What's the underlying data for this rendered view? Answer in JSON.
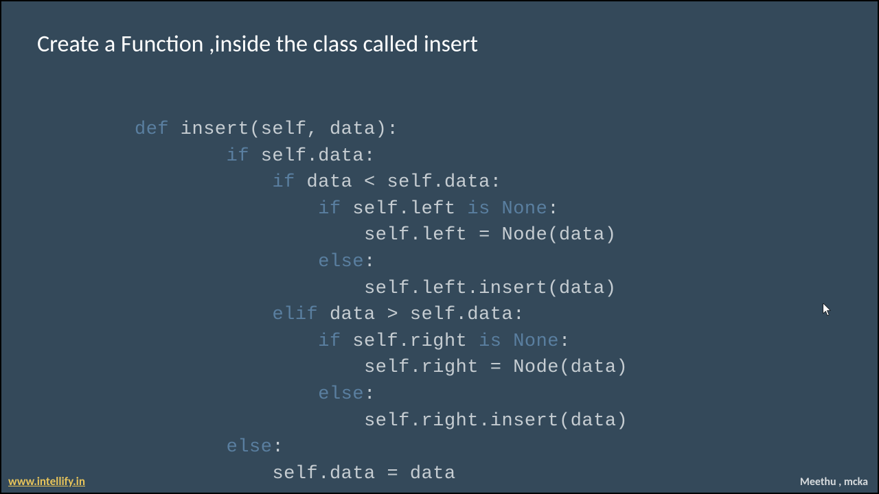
{
  "title": "Create a Function ,inside the class called insert",
  "code": {
    "l1_kw": "def",
    "l1_rest": " insert(self, data):",
    "l2_kw": "if",
    "l2_rest": " self.data:",
    "l3_kw": "if",
    "l3_rest": " data < self.data:",
    "l4_kw1": "if",
    "l4_mid": " self.left ",
    "l4_kw2": "is",
    "l4_sp": " ",
    "l4_kw3": "None",
    "l4_end": ":",
    "l5": "self.left = Node(data)",
    "l6_kw": "else",
    "l6_end": ":",
    "l7": "self.left.insert(data)",
    "l8_kw": "elif",
    "l8_rest": " data > self.data:",
    "l9_kw1": "if",
    "l9_mid": " self.right ",
    "l9_kw2": "is",
    "l9_sp": " ",
    "l9_kw3": "None",
    "l9_end": ":",
    "l10": "self.right = Node(data)",
    "l11_kw": "else",
    "l11_end": ":",
    "l12": "self.right.insert(data)",
    "l13_kw": "else",
    "l13_end": ":",
    "l14": "self.data = data"
  },
  "footer_link": "www.intellify.in",
  "author": "Meethu , mcka"
}
